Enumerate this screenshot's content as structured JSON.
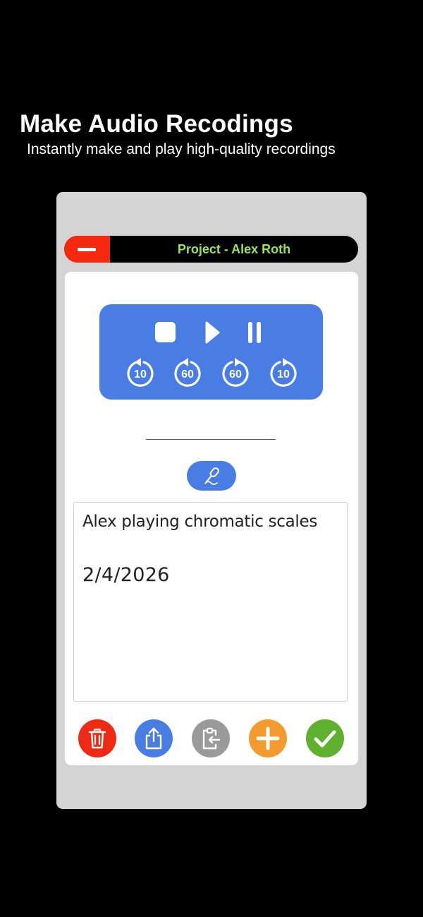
{
  "promo": {
    "headline": "Make Audio Recodings",
    "subhead": "Instantly make and play high-quality recordings"
  },
  "titlebar": {
    "title": "Project - Alex Roth"
  },
  "player": {
    "controls": [
      "stop-icon",
      "play-icon",
      "pause-icon"
    ],
    "skip_buttons": [
      {
        "icon": "rewind-icon",
        "label": "10"
      },
      {
        "icon": "rewind-icon",
        "label": "60"
      },
      {
        "icon": "forward-icon",
        "label": "60"
      },
      {
        "icon": "forward-icon",
        "label": "10"
      }
    ]
  },
  "notes": {
    "line1": "Alex playing chromatic scales",
    "line2": "2/4/2026"
  },
  "actions": [
    {
      "name": "delete-button",
      "icon": "trash-icon",
      "color": "#ee2a14"
    },
    {
      "name": "share-button",
      "icon": "share-icon",
      "color": "#4a7de3"
    },
    {
      "name": "paste-button",
      "icon": "clipboard-icon",
      "color": "#9a9a9a"
    },
    {
      "name": "add-button",
      "icon": "plus-icon",
      "color": "#f29b2e"
    },
    {
      "name": "confirm-button",
      "icon": "checkmark-icon",
      "color": "#5fb02e"
    }
  ],
  "colors": {
    "accent_blue": "#4a7de3",
    "title_green": "#9be35a",
    "minus_red": "#f4290f",
    "device_gray": "#d4d4d4"
  }
}
